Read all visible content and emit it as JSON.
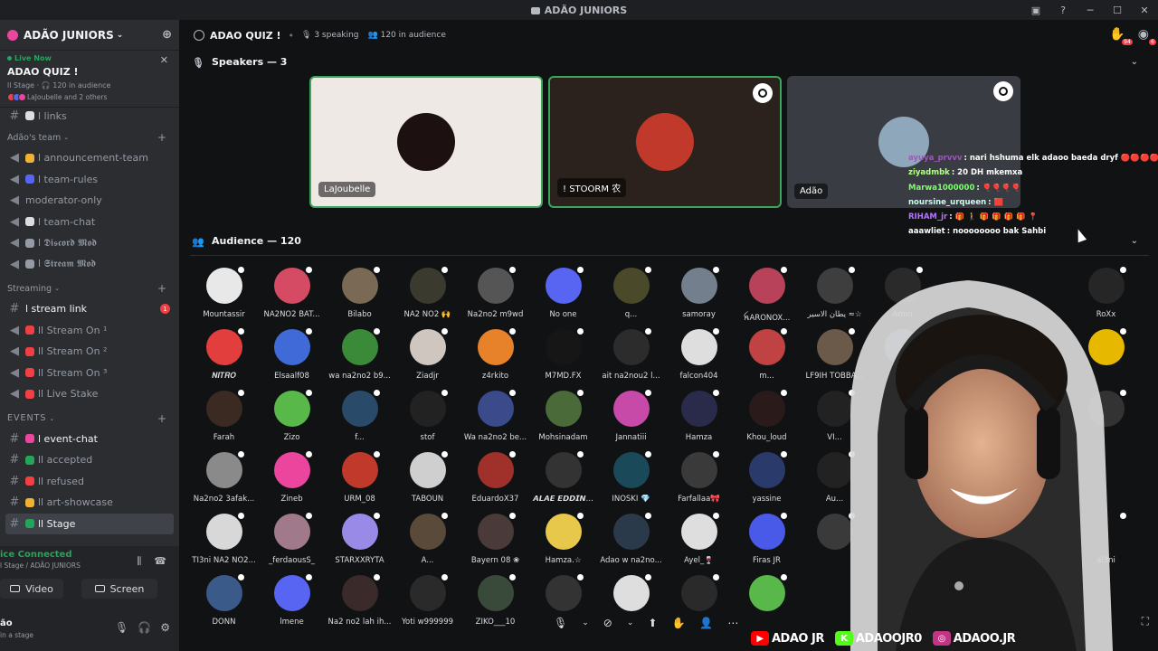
{
  "window": {
    "title": "ADÃO JUNIORS"
  },
  "server": {
    "name": "ADÃO JUNIORS"
  },
  "live": {
    "status": "Live Now",
    "title": "ADAO QUIZ !",
    "meta": "ll Stage · 🎧 120 in audience",
    "people": "LaJoubelle and 2 others"
  },
  "channels_top": [
    {
      "label": "l links"
    }
  ],
  "categories": {
    "team": "Adão's team",
    "streaming": "Streaming",
    "events": "EVENTS"
  },
  "team_channels": [
    {
      "label": "l announcement-team",
      "color": "#f0b232"
    },
    {
      "label": "l team-rules",
      "color": "#5865f2"
    },
    {
      "label": "moderator-only",
      "color": ""
    },
    {
      "label": "l team-chat",
      "color": "#dbdee1"
    },
    {
      "label": "l 𝕯𝖎𝖘𝖈𝖔𝖗𝖉 𝕸𝖔𝖉",
      "color": "#949ba4"
    },
    {
      "label": "l 𝕾𝖙𝖗𝖊𝖆𝖒 𝕸𝖔𝖉",
      "color": "#949ba4"
    }
  ],
  "streaming_channels": [
    {
      "label": "l stream  link",
      "color": "",
      "badge": "1",
      "active": true
    },
    {
      "label": "ll Stream On ¹",
      "color": "#f23f43"
    },
    {
      "label": "ll Stream On ²",
      "color": "#f23f43"
    },
    {
      "label": "ll Stream On ³",
      "color": "#f23f43"
    },
    {
      "label": "ll Live Stake",
      "color": "#f23f43"
    }
  ],
  "event_channels": [
    {
      "label": "l event-chat",
      "color": "#eb459e",
      "active": true
    },
    {
      "label": "ll accepted",
      "color": "#23a55a"
    },
    {
      "label": "ll refused",
      "color": "#f23f43"
    },
    {
      "label": "ll art-showcase",
      "color": "#f0b232"
    },
    {
      "label": "ll Stage",
      "color": "#23a55a",
      "active": true
    }
  ],
  "voice": {
    "status": "ice Connected",
    "sub": "l Stage / ADÃO JUNIORS",
    "video_label": "Video",
    "screen_label": "Screen",
    "user_name": "ão",
    "user_sub": "in a stage"
  },
  "stage": {
    "name": "ADAO QUIZ !",
    "speaking": "3 speaking",
    "audience_count": "120 in audience",
    "inbox_count": "94",
    "notif_count": "6",
    "speakers_header": "Speakers — 3",
    "audience_header": "Audience — 120"
  },
  "speakers": [
    {
      "name": "LaJoubelle",
      "bg": "#efe9e6",
      "border": "#3ba55c",
      "avatar": "#1c1010"
    },
    {
      "name": "! STOORM 农",
      "bg": "#2b221d",
      "border": "#3ba55c",
      "avatar": "#c0392b"
    },
    {
      "name": "Adão",
      "bg": "#3a3c43",
      "border": "",
      "avatar": "#8fa7bb"
    }
  ],
  "chat": [
    {
      "user": "ayuya_prvvv",
      "msg": ": nari hshuma elk adaoo baeda dryf 🔴🔴🔴🔴🔴🔴",
      "color": "#9b59b6"
    },
    {
      "user": "ziyadmbk",
      "msg": ": 20 DH mkemxa",
      "color": "#b5ff8a"
    },
    {
      "user": "Marwa1000000",
      "msg": ": 🎈🎈🎈🎈",
      "color": "#7cff6b"
    },
    {
      "user": "noursine_urqueen",
      "msg": ": 🟥",
      "color": "#c8ffef"
    },
    {
      "user": "RIHAM_jr",
      "msg": ": 🎁 🚶 🎁 🎁 🎁 🎁 📍",
      "color": "#b673ff"
    },
    {
      "user": "aaawliet",
      "msg": ": noooooooo bak Sahbi",
      "color": "#ffffff"
    }
  ],
  "audience": [
    [
      {
        "name": "Mountassir",
        "color": "#e8e8e8"
      },
      {
        "name": "NA2NO2 BAT...",
        "color": "#d44b63"
      },
      {
        "name": "Bilabo",
        "color": "#7a6a55"
      },
      {
        "name": "NA2 NO2 🙌",
        "color": "#3a3a2e"
      },
      {
        "name": "Na2no2 m9wd",
        "color": "#555"
      },
      {
        "name": "No one",
        "color": "#5865f2"
      },
      {
        "name": "q...",
        "color": "#4a4a2a"
      },
      {
        "name": "samoray",
        "color": "#747f8d"
      },
      {
        "name": "ꫝARONOX...",
        "color": "#b8425a"
      },
      {
        "name": "يطان الاسير ≈☆",
        "color": "#3e3e3e"
      },
      {
        "name": "Amin",
        "color": "#2a2a2a"
      },
      {
        "name": "",
        "color": "#111214"
      },
      {
        "name": "",
        "color": "#111214"
      },
      {
        "name": "RoXx",
        "color": "#262626"
      }
    ],
    [
      {
        "name": "𝑵𝑰𝑻𝑹𝑶",
        "color": "#e23e3e"
      },
      {
        "name": "Elsaalf08",
        "color": "#3f6ad8"
      },
      {
        "name": "wa na2no2 b9...",
        "color": "#3a8a3a"
      },
      {
        "name": "Ziadjr",
        "color": "#cfc6bf"
      },
      {
        "name": "z4rkito",
        "color": "#e8822a"
      },
      {
        "name": "M7MD.FX",
        "color": "#161616"
      },
      {
        "name": "ait na2nou2 l...",
        "color": "#2c2c2c"
      },
      {
        "name": "falcon404",
        "color": "#dedede"
      },
      {
        "name": "m...",
        "color": "#c14242"
      },
      {
        "name": "LF9IH TOBBA...",
        "color": "#6b5a4a"
      },
      {
        "name": "Souha",
        "color": "#4a6a9a"
      },
      {
        "name": "",
        "color": "#111214"
      },
      {
        "name": "",
        "color": "#111214"
      },
      {
        "name": "",
        "color": "#e6b800"
      }
    ],
    [
      {
        "name": "Farah",
        "color": "#3a2a22"
      },
      {
        "name": "Zizo",
        "color": "#58b84a"
      },
      {
        "name": "f...",
        "color": "#2a4a6a"
      },
      {
        "name": "stof",
        "color": "#222"
      },
      {
        "name": "Wa na2no2 be...",
        "color": "#3a4a8a"
      },
      {
        "name": "Mohsinadam",
        "color": "#4a6a3a"
      },
      {
        "name": "Jannatiii",
        "color": "#c84aa8"
      },
      {
        "name": "Hamza",
        "color": "#2a2a4a"
      },
      {
        "name": "Khou_loud",
        "color": "#2a1a1a"
      },
      {
        "name": "VI...",
        "color": "#222"
      },
      {
        "name": "",
        "color": "#111214"
      },
      {
        "name": "",
        "color": "#111214"
      },
      {
        "name": "",
        "color": "#111214"
      },
      {
        "name": "",
        "color": "#333"
      }
    ],
    [
      {
        "name": "Na2no2 3afak...",
        "color": "#8a8a8a"
      },
      {
        "name": "Zineb",
        "color": "#eb459e"
      },
      {
        "name": "URM_08",
        "color": "#c0392b"
      },
      {
        "name": "TABOUN",
        "color": "#cfcfcf"
      },
      {
        "name": "EduardoX37",
        "color": "#a0302a"
      },
      {
        "name": "𝘼𝙇𝘼𝙀 𝙀𝘿𝘿𝙄𝙉...",
        "color": "#333"
      },
      {
        "name": "INOSKI 💎",
        "color": "#1a4a5a"
      },
      {
        "name": "Farfallaa🎀",
        "color": "#3a3a3a"
      },
      {
        "name": "yassine",
        "color": "#2a3a6a"
      },
      {
        "name": "Au...",
        "color": "#222"
      },
      {
        "name": "",
        "color": "#111214"
      },
      {
        "name": "",
        "color": "#111214"
      },
      {
        "name": "",
        "color": "#111214"
      },
      {
        "name": "",
        "color": "#111214"
      }
    ],
    [
      {
        "name": "TI3ni NA2 NO2...",
        "color": "#d8d8d8"
      },
      {
        "name": "_ferdaousS_",
        "color": "#a07a8a"
      },
      {
        "name": "STARXXRYTA",
        "color": "#9a8ae8"
      },
      {
        "name": "A...",
        "color": "#5a4a3a"
      },
      {
        "name": "Bayern 08 ❀",
        "color": "#4a3a3a"
      },
      {
        "name": "Hamza.☆",
        "color": "#e8c84a"
      },
      {
        "name": "Adao w na2no...",
        "color": "#2a3a4a"
      },
      {
        "name": "Ayel_🍷",
        "color": "#dedede"
      },
      {
        "name": "Firas JR",
        "color": "#4a5ae8"
      },
      {
        "name": "",
        "color": "#3a3a3a"
      },
      {
        "name": "",
        "color": "#111214"
      },
      {
        "name": "",
        "color": "#111214"
      },
      {
        "name": "",
        "color": "#111214"
      },
      {
        "name": "al3ni",
        "color": "#111214"
      }
    ],
    [
      {
        "name": "DONN",
        "color": "#3a5a8a"
      },
      {
        "name": "lmene",
        "color": "#5865f2"
      },
      {
        "name": "Na2 no2 lah ih...",
        "color": "#3a2a2a"
      },
      {
        "name": "Yoti w999999",
        "color": "#2a2a2a"
      },
      {
        "name": "ZIKO___10",
        "color": "#3a4a3a"
      },
      {
        "name": "",
        "color": "#333"
      },
      {
        "name": "",
        "color": "#dedede"
      },
      {
        "name": "",
        "color": "#2a2a2a"
      },
      {
        "name": "",
        "color": "#58b84a"
      }
    ]
  ],
  "socials": [
    {
      "label": "ADAO JR",
      "color": "#ff0000",
      "glyph": "▶"
    },
    {
      "label": "ADAOOJR0",
      "color": "#53fc18",
      "glyph": "K"
    },
    {
      "label": "ADAOO.JR",
      "color": "#c13584",
      "glyph": "◎"
    }
  ]
}
